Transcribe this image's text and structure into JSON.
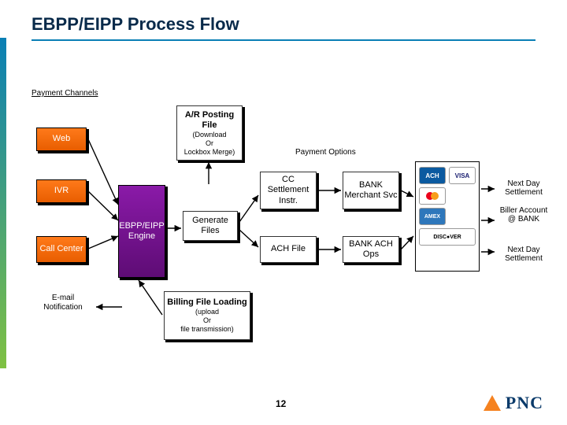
{
  "title": "EBPP/EIPP Process Flow",
  "section_channels": "Payment Channels",
  "section_options": "Payment Options",
  "channels": {
    "web": "Web",
    "ivr": "IVR",
    "call": "Call Center",
    "email": "E-mail Notification"
  },
  "engine": "EBPP/EIPP Engine",
  "ar_file": {
    "title": "A/R Posting File",
    "sub": "(Download\nOr\nLockbox Merge)"
  },
  "generate": "Generate Files",
  "billing": {
    "title": "Billing File Loading",
    "sub": "(upload\nOr\nfile transmission)"
  },
  "options": {
    "cc": "CC Settlement Instr.",
    "ach": "ACH File",
    "merchant": "BANK Merchant Svc",
    "achops": "BANK ACH Ops"
  },
  "notes": {
    "nds1": "Next Day Settlement",
    "biller": "Biller Account @ BANK",
    "nds2": "Next Day Settlement"
  },
  "logos": [
    "ACH",
    "VISA",
    "mc",
    "AMEX",
    "",
    "DISCOVER"
  ],
  "page_number": "12",
  "brand": "PNC"
}
